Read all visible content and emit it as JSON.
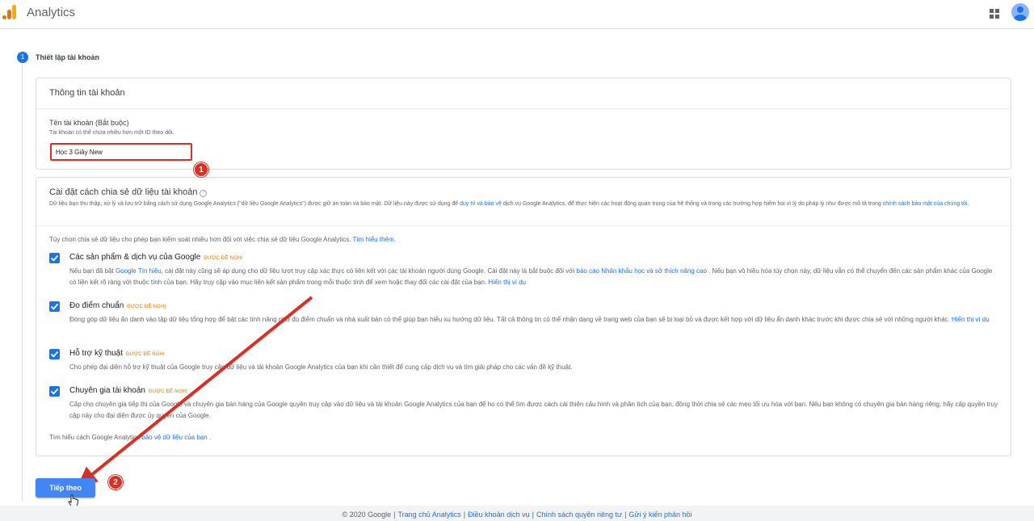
{
  "app": {
    "title": "Analytics"
  },
  "step": {
    "number": "1",
    "title": "Thiết lập tài khoản"
  },
  "account_card": {
    "header": "Thông tin tài khoản",
    "name_label": "Tên tài khoản (Bắt buộc)",
    "name_hint": "Tài khoản có thể chứa nhiều hơn một ID theo dõi.",
    "name_value": "Học 3 Giây New"
  },
  "sharing_card": {
    "title": "Cài đặt cách chia sẻ dữ liệu tài khoản",
    "desc_part1": "Dữ liệu bạn thu thập, xử lý và lưu trữ bằng cách sử dụng Google Analytics (\"dữ liệu Google Analytics\") được giữ an toàn và bảo mật. Dữ liệu này được sử dụng để ",
    "desc_link1": "duy trì và bảo vệ",
    "desc_part2": " dịch vụ Google Analytics, để thực hiện các hoạt động quan trọng của hệ thống và trong các trường hợp hiếm hoi vì lý do pháp lý như được mô tả trong ",
    "desc_link2": "chính sách bảo mật của chúng tôi",
    "desc_part3": ".",
    "intro_text": "Tùy chọn chia sẻ dữ liệu cho phép bạn kiểm soát nhiều hơn đối với việc chia sẻ dữ liệu Google Analytics. ",
    "intro_link": "Tìm hiểu thêm",
    "intro_end": ".",
    "recommended": "ĐƯỢC ĐỀ NGHỊ",
    "options": [
      {
        "title": "Các sản phẩm & dịch vụ của Google",
        "desc_a": "Nếu bạn đã bật ",
        "link_a": "Google Tín hiệu",
        "desc_b": ", cài đặt này cũng sẽ áp dụng cho dữ liệu lượt truy cập xác thực có liên kết với các tài khoản người dùng Google. Cài đặt này là bắt buộc đối với ",
        "link_b": "báo cáo Nhân khẩu học và sở thích nâng cao",
        "desc_c": " . Nếu bạn vô hiệu hóa tùy chọn này, dữ liệu vẫn có thể chuyển đến các sản phẩm khác của Google có liên kết rõ ràng với thuộc tính của bạn. Hãy truy cập vào mục liên kết sản phẩm trong mỗi thuộc tính để xem hoặc thay đổi các cài đặt của bạn. ",
        "link_c": "Hiển thị ví dụ"
      },
      {
        "title": "Đo điểm chuẩn",
        "desc_a": "Đóng góp dữ liệu ẩn danh vào tập dữ liệu tổng hợp để bật các tính năng như đo điểm chuẩn và nhà xuất bản có thể giúp bạn hiểu xu hướng dữ liệu. Tất cả thông tin có thể nhận dạng về trang web của bạn sẽ bị loại bỏ và được kết hợp với dữ liệu ẩn danh khác trước khi được chia sẻ với những người khác. ",
        "link_a": "Hiển thị ví dụ"
      },
      {
        "title": "Hỗ trợ kỹ thuật",
        "desc_a": "Cho phép đại diện hỗ trợ kỹ thuật của Google truy cập dữ liệu và tài khoản Google Analytics của bạn khi cần thiết để cung cấp dịch vụ và tìm giải pháp cho các vấn đề kỹ thuật."
      },
      {
        "title": "Chuyên gia tài khoản",
        "desc_a": "Cấp cho chuyên gia tiếp thị của Google và chuyên gia bán hàng của Google quyền truy cập vào dữ liệu và tài khoản Google Analytics của bạn để họ có thể tìm được cách cải thiện cấu hình và phân tích của bạn, đồng thời chia sẻ các mẹo tối ưu hóa với bạn. Nếu bạn không có chuyên gia bán hàng riêng, hãy cấp quyền truy cập này cho đại diện được ủy quyền của Google."
      }
    ],
    "learn_text": "Tìm hiểu cách Google Analytics ",
    "learn_link": "bảo vệ dữ liệu của bạn",
    "learn_end": " ."
  },
  "next_button": "Tiếp theo",
  "annotations": {
    "badge1": "1",
    "badge2": "2"
  },
  "footer": {
    "copyright": "© 2020 Google",
    "links": [
      "Trang chủ Analytics",
      "Điều khoản dịch vụ",
      "Chính sách quyền riêng tư",
      "Gửi ý kiến phản hồi"
    ]
  },
  "colors": {
    "accent": "#1a73e8",
    "button": "#4285f4",
    "annotation": "#d93025",
    "recommended": "#e37400"
  },
  "icons": [
    "analytics-logo-icon",
    "apps-grid-icon",
    "avatar",
    "help-icon",
    "checkbox-checked-icon",
    "cursor-hand-icon"
  ]
}
